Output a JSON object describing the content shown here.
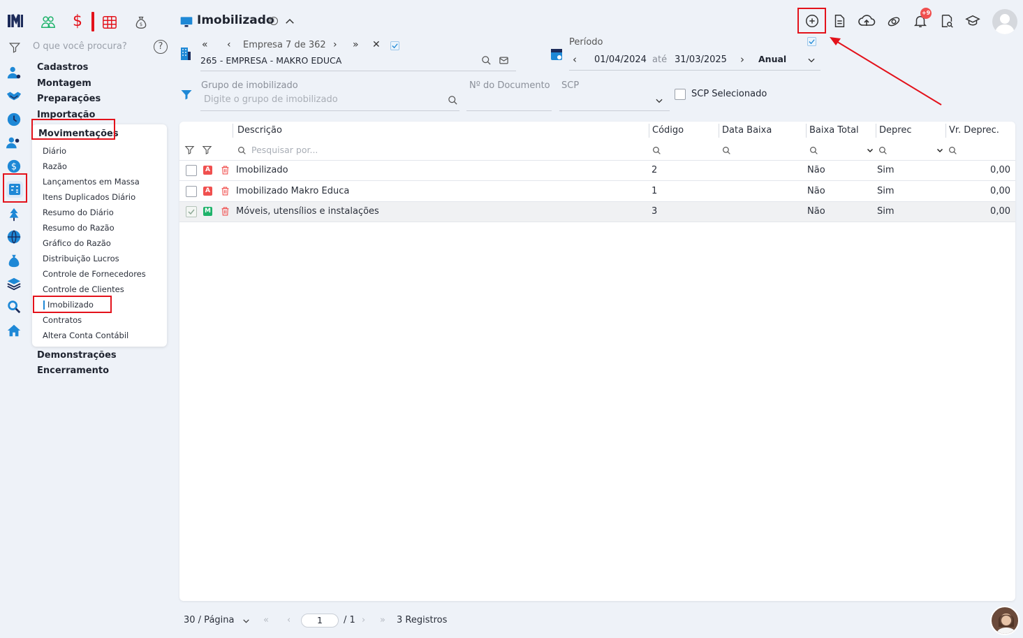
{
  "topbar": {
    "apps": [
      "people-icon",
      "dollar-icon",
      "grid-table-icon",
      "money-bag-icon"
    ],
    "page_title": "Imobilizado",
    "actions": [
      "add-circle-icon",
      "document-icon",
      "cloud-upload-icon",
      "satellite-icon",
      "bell-icon",
      "search-document-icon",
      "graduation-cap-icon",
      "avatar"
    ],
    "notif_count": "+9"
  },
  "sidebar": {
    "search_placeholder": "O que você procura?",
    "sections": {
      "cadastros": "Cadastros",
      "montagem": "Montagem",
      "preparacoes": "Preparações",
      "importacao": "Importação",
      "movimentacoes": "Movimentações",
      "demonstracoes": "Demonstrações",
      "encerramento": "Encerramento"
    },
    "items": [
      "Diário",
      "Razão",
      "Lançamentos em Massa",
      "Itens Duplicados Diário",
      "Resumo do Diário",
      "Resumo do Razão",
      "Gráfico do Razão",
      "Distribuição Lucros",
      "Controle de Fornecedores",
      "Controle de Clientes",
      "Imobilizado",
      "Contratos",
      "Altera Conta Contábil"
    ],
    "active_item": "Imobilizado"
  },
  "filters": {
    "empresa_nav": "Empresa 7 de 362",
    "empresa_value": "265 - EMPRESA - MAKRO EDUCA",
    "periodo_label": "Período",
    "date_from": "01/04/2024",
    "ate": "até",
    "date_to": "31/03/2025",
    "period_type": "Anual",
    "grupo_label": "Grupo de imobilizado",
    "grupo_placeholder": "Digite o grupo de imobilizado",
    "doc_label": "Nº do Documento",
    "scp_label": "SCP",
    "scp_selected_label": "SCP Selecionado"
  },
  "table": {
    "columns": [
      "Descrição",
      "Código",
      "Data Baixa",
      "Baixa Total",
      "Deprec",
      "Vr. Deprec."
    ],
    "search_placeholder": "Pesquisar por...",
    "rows": [
      {
        "badge": "A",
        "badge_color": "#f0504f",
        "descricao": "Imobilizado",
        "codigo": "2",
        "data_baixa": "",
        "baixa_total": "Não",
        "deprec": "Sim",
        "vr_deprec": "0,00",
        "checked": false
      },
      {
        "badge": "A",
        "badge_color": "#f0504f",
        "descricao": "Imobilizado Makro Educa",
        "codigo": "1",
        "data_baixa": "",
        "baixa_total": "Não",
        "deprec": "Sim",
        "vr_deprec": "0,00",
        "checked": false
      },
      {
        "badge": "M",
        "badge_color": "#1fb36b",
        "descricao": "Móveis, utensílios e instalações",
        "codigo": "3",
        "data_baixa": "",
        "baixa_total": "Não",
        "deprec": "Sim",
        "vr_deprec": "0,00",
        "checked": true
      }
    ]
  },
  "footer": {
    "per_page": "30 / Página",
    "page": "1",
    "total_pages": "/ 1",
    "registros": "3 Registros"
  },
  "colors": {
    "accent": "#1e88d6",
    "highlight": "#e3121b",
    "navy": "#1c2b5a"
  }
}
